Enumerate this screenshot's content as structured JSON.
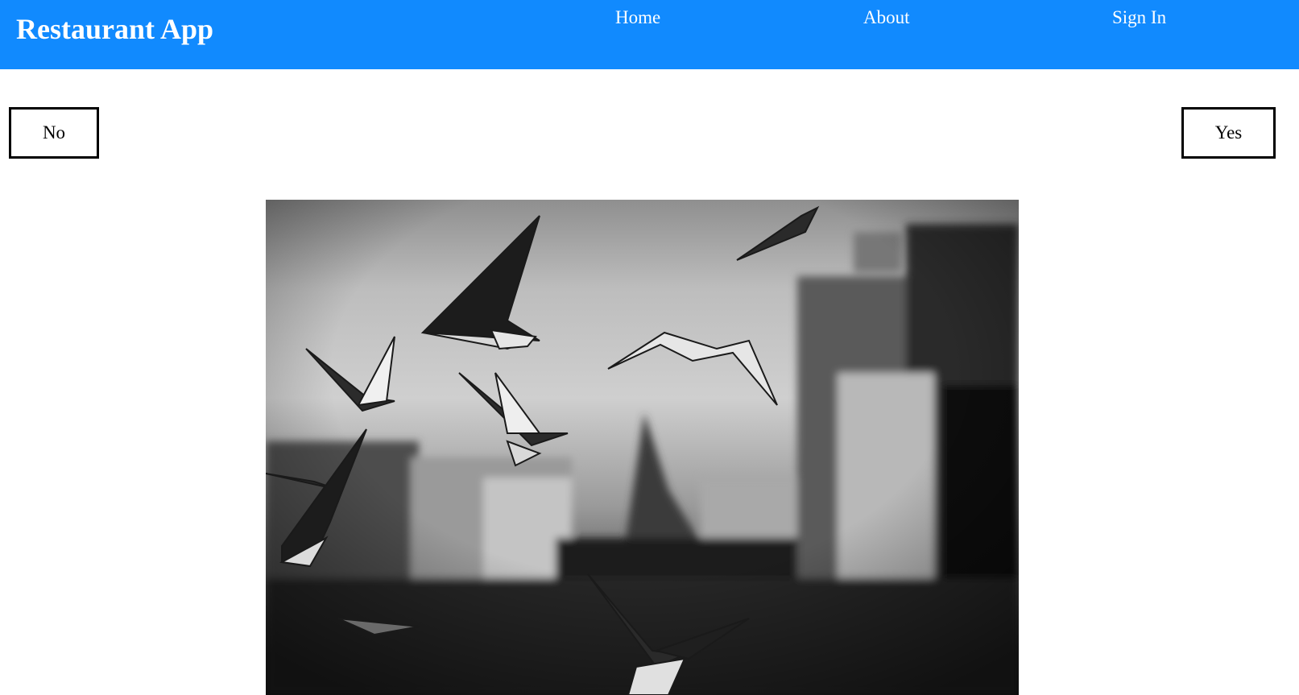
{
  "navbar": {
    "brand": "Restaurant App",
    "links": [
      {
        "label": "Home"
      },
      {
        "label": "About"
      },
      {
        "label": "Sign In"
      }
    ],
    "background_color": "#118afe"
  },
  "choices": {
    "no_label": "No",
    "yes_label": "Yes"
  },
  "image": {
    "subject": "black-and-white photo of seagulls flying over city buildings"
  }
}
